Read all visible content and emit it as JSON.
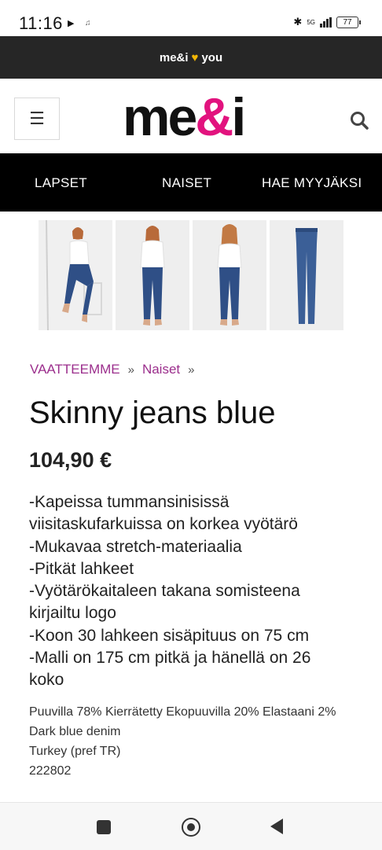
{
  "status_bar": {
    "time": "11:16",
    "network": "5G",
    "battery": "77"
  },
  "promo_banner": {
    "text_left": "me&i",
    "text_right": "you"
  },
  "header": {
    "logo_left": "me",
    "logo_amp": "&",
    "logo_right": "i"
  },
  "nav": {
    "items": [
      "LAPSET",
      "NAISET",
      "HAE MYYJÄKSI"
    ]
  },
  "breadcrumb": {
    "items": [
      "VAATTEEMME",
      "Naiset"
    ],
    "separator": "»"
  },
  "product": {
    "title": "Skinny jeans blue",
    "price": "104,90 €",
    "description_lines": [
      "-Kapeissa tummansinisissä",
      "viisitaskufarkuissa on korkea vyötärö",
      "-Mukavaa stretch-materiaalia",
      "-Pitkät lahkeet",
      "-Vyötärökaitaleen takana somisteena",
      "kirjailtu logo",
      "-Koon 30 lahkeen sisäpituus on 75 cm",
      "-Malli on 175 cm pitkä ja hänellä on 26",
      "koko"
    ],
    "material": "Puuvilla 78% Kierrätetty Ekopuuvilla 20% Elastaani 2%",
    "color": "Dark blue denim",
    "origin": "Turkey (pref TR)",
    "code": "222802"
  },
  "colors": {
    "accent": "#e2137e",
    "link": "#9b2e8c",
    "nav_bg": "#000000",
    "promo_bg": "#262626",
    "heart": "#f2b705"
  }
}
